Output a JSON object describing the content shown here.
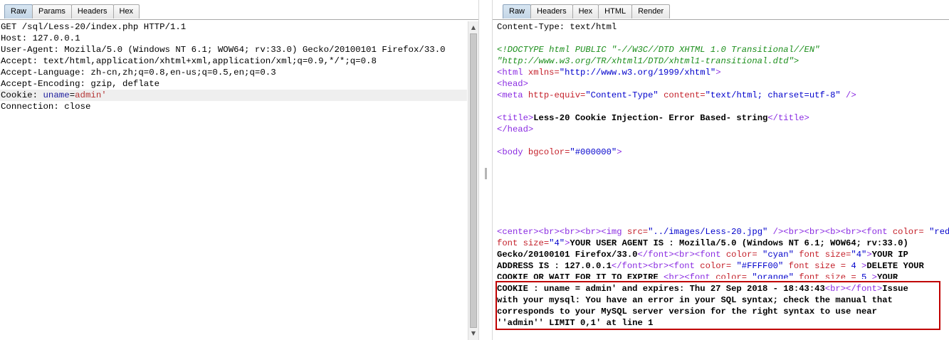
{
  "request": {
    "tabs": [
      "Raw",
      "Params",
      "Headers",
      "Hex"
    ],
    "lines": [
      "GET /sql/Less-20/index.php HTTP/1.1",
      "Host: 127.0.0.1",
      "User-Agent: Mozilla/5.0 (Windows NT 6.1; WOW64; rv:33.0) Gecko/20100101 Firefox/33.0",
      "Accept: text/html,application/xhtml+xml,application/xml;q=0.9,*/*;q=0.8",
      "Accept-Language: zh-cn,zh;q=0.8,en-us;q=0.5,en;q=0.3",
      "Accept-Encoding: gzip, deflate"
    ],
    "cookie_prefix": "Cookie: ",
    "cookie_name": "uname",
    "cookie_eq": "=",
    "cookie_value": "admin'",
    "last_line": "Connection: close"
  },
  "response": {
    "tabs": [
      "Raw",
      "Headers",
      "Hex",
      "HTML",
      "Render"
    ],
    "content_type": "Content-Type: text/html",
    "doctype_1": "<!DOCTYPE html PUBLIC \"-//W3C//DTD XHTML 1.0 Transitional//EN\"",
    "doctype_2": "\"http://www.w3.org/TR/xhtml1/DTD/xhtml1-transitional.dtd\">",
    "html_open": "<html",
    "xmlns_attr": " xmlns=",
    "xmlns_val": "\"http://www.w3.org/1999/xhtml\"",
    "html_close": ">",
    "head_open": "<head>",
    "meta_open": "<meta",
    "meta_attr1": " http-equiv=",
    "meta_val1": "\"Content-Type\"",
    "meta_attr2": " content=",
    "meta_val2": "\"text/html; charset=utf-8\"",
    "meta_close": " />",
    "title_open": "<title>",
    "title_text": "Less-20 Cookie Injection- Error Based- string",
    "title_close": "</title>",
    "head_close": "</head>",
    "body_open": "<body",
    "body_attr": " bgcolor=",
    "body_val": "\"#000000\"",
    "body_close": ">",
    "l1a": "<center><br><br><br><img",
    "l1b": " src=",
    "l1c": "\"../images/Less-20.jpg\"",
    "l1d": " /><br><br><b><br><font",
    "l1e": " color=",
    "l1f": " \"red\"",
    "l2a": "font size=",
    "l2b": "\"4\"",
    "l2c": ">",
    "l2d": "YOUR USER AGENT IS : Mozilla/5.0 (Windows NT 6.1; WOW64; rv:33.0)",
    "l3a": "Gecko/20100101 Firefox/33.0",
    "l3b": "</font><br><font",
    "l3c": " color=",
    "l3d": " \"cyan\"",
    "l3e": " font size=",
    "l3f": "\"4\"",
    "l3g": ">",
    "l3h": "YOUR IP",
    "l4a": "ADDRESS IS : 127.0.0.1",
    "l4b": "</font><br><font",
    "l4c": " color=",
    "l4d": " \"#FFFF00\"",
    "l4e": " font size = ",
    "l4f": "4",
    "l4g": " >",
    "l4h": "DELETE YOUR",
    "l5a": "COOKIE OR WAIT FOR IT TO EXPIRE ",
    "l5b": "<br><font",
    "l5c": " color=",
    "l5d": " \"orange\"",
    "l5e": " font size = ",
    "l5f": "5",
    "l5g": " >",
    "l5h": "YOUR",
    "l6a": "COOKIE : uname = admin' and expires: Thu 27 Sep 2018 - 18:43:43",
    "l6b": "<br></font>",
    "l6c": "Issue",
    "l7": "with your mysql: You have an error in your SQL syntax; check the manual that",
    "l8": "corresponds to your MySQL server version for the right syntax to use near",
    "l9": "''admin'' LIMIT 0,1' at line 1"
  }
}
